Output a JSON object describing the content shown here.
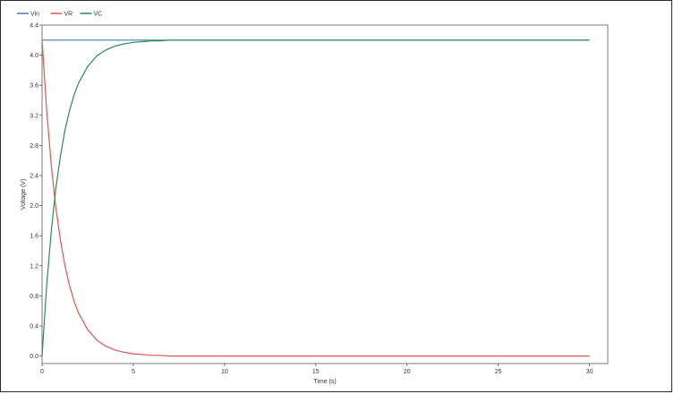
{
  "chart_data": {
    "type": "line",
    "xlabel": "Time (s)",
    "ylabel": "Voltage (V)",
    "xlim": [
      0,
      31
    ],
    "ylim": [
      -0.1,
      4.4
    ],
    "xticks": [
      0,
      5,
      10,
      15,
      20,
      25,
      30
    ],
    "yticks": [
      0.0,
      0.4,
      0.8,
      1.2,
      1.6,
      2.0,
      2.4,
      2.8,
      3.2,
      3.6,
      4.0,
      4.4
    ],
    "grid": false,
    "legend_position": "top-left",
    "x": [
      0,
      0.25,
      0.5,
      0.75,
      1,
      1.25,
      1.5,
      1.75,
      2,
      2.5,
      3,
      3.5,
      4,
      4.5,
      5,
      5.5,
      6,
      6.5,
      7,
      8,
      10,
      12,
      15,
      20,
      25,
      30
    ],
    "series": [
      {
        "name": "Vin",
        "color": "#4a7ab5",
        "values": [
          4.2,
          4.2,
          4.2,
          4.2,
          4.2,
          4.2,
          4.2,
          4.2,
          4.2,
          4.2,
          4.2,
          4.2,
          4.2,
          4.2,
          4.2,
          4.2,
          4.2,
          4.2,
          4.2,
          4.2,
          4.2,
          4.2,
          4.2,
          4.2,
          4.2,
          4.2
        ]
      },
      {
        "name": "VR",
        "color": "#e05555",
        "values": [
          4.2,
          3.27,
          2.55,
          1.98,
          1.55,
          1.2,
          0.94,
          0.73,
          0.57,
          0.35,
          0.21,
          0.13,
          0.08,
          0.05,
          0.03,
          0.02,
          0.01,
          0.01,
          0.0,
          0.0,
          0.0,
          0.0,
          0.0,
          0.0,
          0.0,
          0.0
        ]
      },
      {
        "name": "VC",
        "color": "#2e8b57",
        "values": [
          0.0,
          0.93,
          1.65,
          2.22,
          2.65,
          3.0,
          3.26,
          3.47,
          3.63,
          3.85,
          3.99,
          4.07,
          4.12,
          4.15,
          4.17,
          4.18,
          4.19,
          4.19,
          4.2,
          4.2,
          4.2,
          4.2,
          4.2,
          4.2,
          4.2,
          4.2
        ]
      }
    ]
  }
}
